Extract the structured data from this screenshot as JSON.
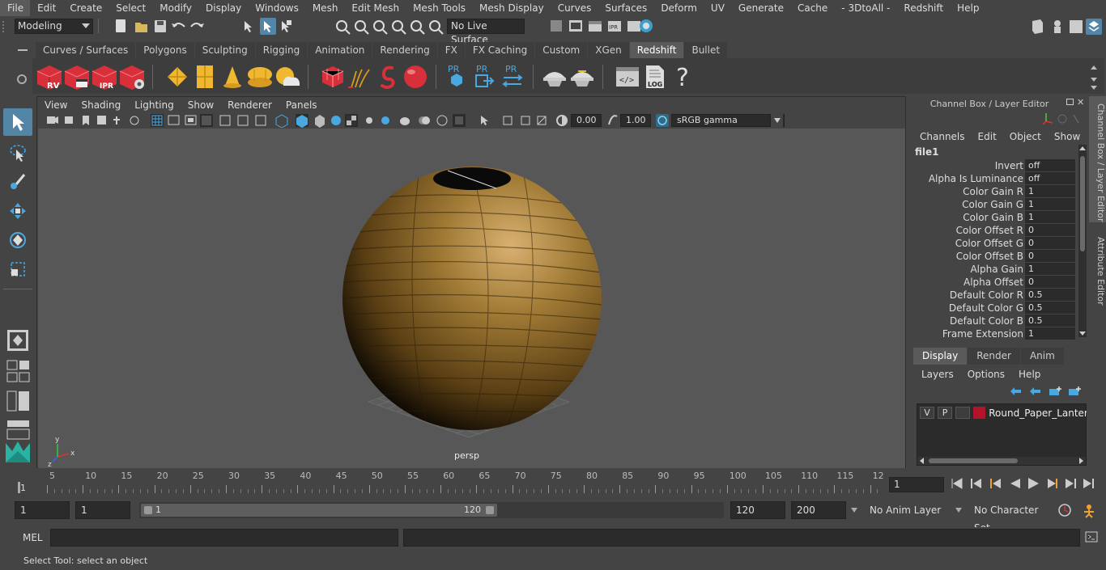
{
  "menubar": {
    "items": [
      "File",
      "Edit",
      "Create",
      "Select",
      "Modify",
      "Display",
      "Windows",
      "Mesh",
      "Edit Mesh",
      "Mesh Tools",
      "Mesh Display",
      "Curves",
      "Surfaces",
      "Deform",
      "UV",
      "Generate",
      "Cache",
      "- 3DtoAll -",
      "Redshift",
      "Help"
    ]
  },
  "statusline": {
    "mode": "Modeling",
    "live_surface": "No Live Surface"
  },
  "shelf": {
    "tabs": [
      "Curves / Surfaces",
      "Polygons",
      "Sculpting",
      "Rigging",
      "Animation",
      "Rendering",
      "FX",
      "FX Caching",
      "Custom",
      "XGen",
      "Redshift",
      "Bullet"
    ],
    "active_tab": "Redshift",
    "icon_labels": {
      "rv": "RV",
      "ipr": "IPR",
      "pr1": "PR",
      "pr2": "PR",
      "pr3": "PR",
      "log": "LOG",
      "help": "?"
    }
  },
  "viewport": {
    "menu": [
      "View",
      "Shading",
      "Lighting",
      "Show",
      "Renderer",
      "Panels"
    ],
    "exposure": "0.00",
    "gamma": "1.00",
    "color_space": "sRGB gamma",
    "camera_label": "persp",
    "axis_labels": {
      "x": "x",
      "y": "y",
      "z": "z"
    }
  },
  "channelbox": {
    "title": "Channel Box / Layer Editor",
    "menu": [
      "Channels",
      "Edit",
      "Object",
      "Show"
    ],
    "node": "file1",
    "attributes": [
      {
        "name": "Invert",
        "value": "off"
      },
      {
        "name": "Alpha Is Luminance",
        "value": "off"
      },
      {
        "name": "Color Gain R",
        "value": "1"
      },
      {
        "name": "Color Gain G",
        "value": "1"
      },
      {
        "name": "Color Gain B",
        "value": "1"
      },
      {
        "name": "Color Offset R",
        "value": "0"
      },
      {
        "name": "Color Offset G",
        "value": "0"
      },
      {
        "name": "Color Offset B",
        "value": "0"
      },
      {
        "name": "Alpha Gain",
        "value": "1"
      },
      {
        "name": "Alpha Offset",
        "value": "0"
      },
      {
        "name": "Default Color R",
        "value": "0.5"
      },
      {
        "name": "Default Color G",
        "value": "0.5"
      },
      {
        "name": "Default Color B",
        "value": "0.5"
      },
      {
        "name": "Frame Extension",
        "value": "1"
      }
    ]
  },
  "layereditor": {
    "tabs": [
      "Display",
      "Render",
      "Anim"
    ],
    "active_tab": "Display",
    "menu": [
      "Layers",
      "Options",
      "Help"
    ],
    "layer": {
      "v": "V",
      "p": "P",
      "name": "Round_Paper_Lantern",
      "color": "#b0132a"
    }
  },
  "sidetabs": [
    "Channel Box / Layer Editor",
    "Attribute Editor"
  ],
  "timeline": {
    "ticks": [
      "5",
      "10",
      "15",
      "20",
      "25",
      "30",
      "35",
      "40",
      "45",
      "50",
      "55",
      "60",
      "65",
      "70",
      "75",
      "80",
      "85",
      "90",
      "95",
      "100",
      "105",
      "110",
      "115",
      "12"
    ],
    "start_marker": "1",
    "current_frame": "1"
  },
  "range": {
    "start": "1",
    "playback_start": "1",
    "slider_start": "1",
    "slider_end": "120",
    "playback_end": "120",
    "end": "200",
    "anim_layer": "No Anim Layer",
    "character_set": "No Character Set"
  },
  "commandline": {
    "label": "MEL"
  },
  "helpline": {
    "text": "Select Tool: select an object"
  },
  "colors": {
    "accent": "#5285a6",
    "lantern": "#a07a35",
    "redshift_red": "#d8303a"
  }
}
